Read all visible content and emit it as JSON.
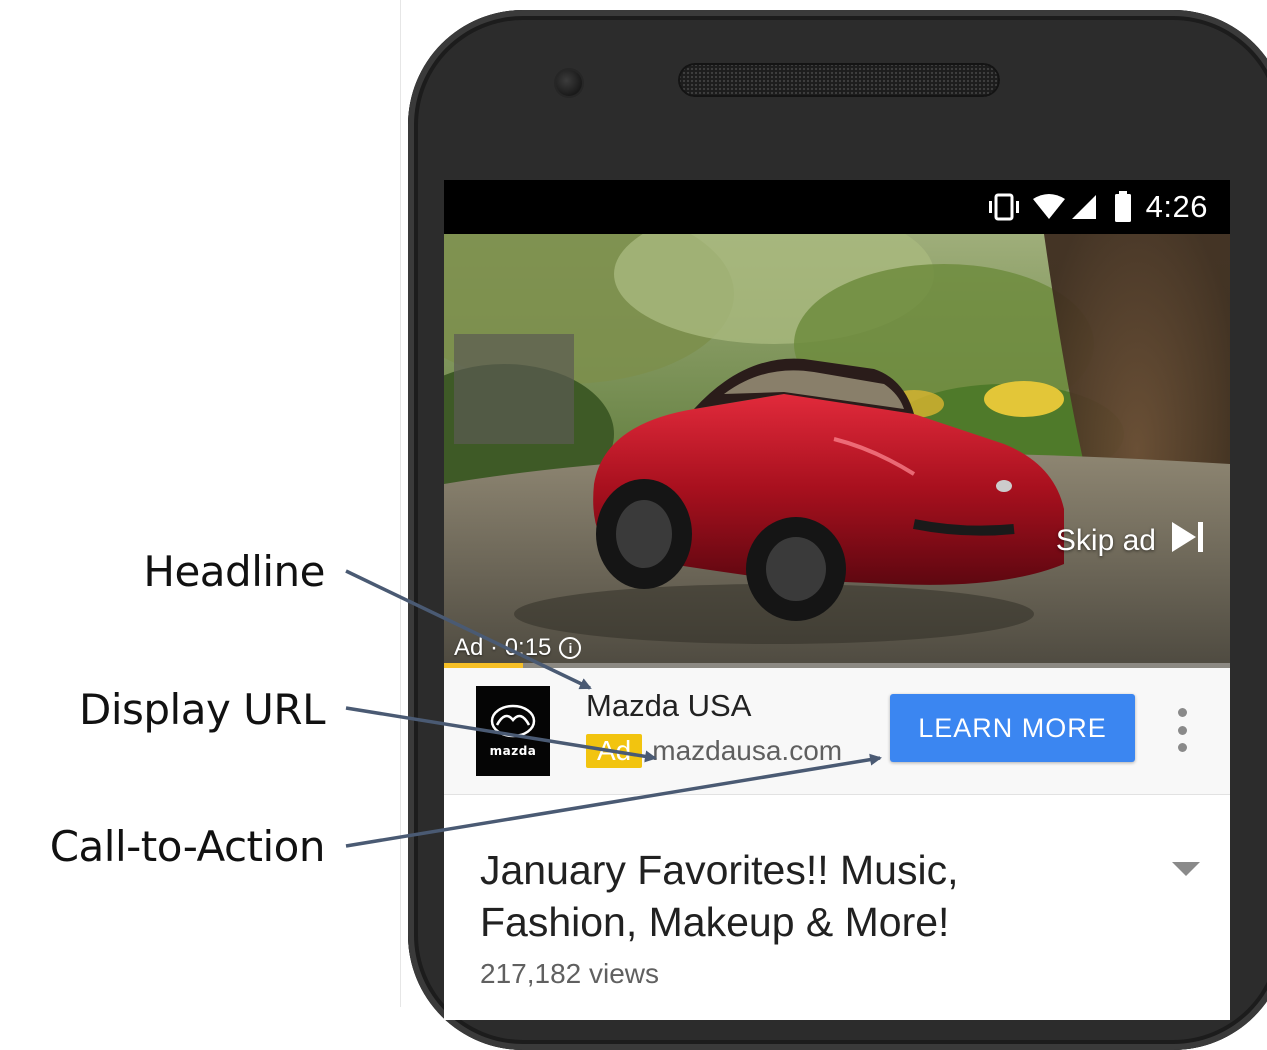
{
  "annotations": {
    "headline": "Headline",
    "display_url": "Display URL",
    "call_to_action": "Call-to-Action"
  },
  "status_bar": {
    "time": "4:26",
    "icons": [
      "vibrate-icon",
      "wifi-icon",
      "signal-icon",
      "battery-icon"
    ]
  },
  "video": {
    "skip_label": "Skip ad",
    "ad_timer": "Ad · 0:15",
    "progress": 0.1
  },
  "ad": {
    "headline": "Mazda USA",
    "badge": "Ad",
    "display_url": "mazdausa.com",
    "cta_label": "LEARN MORE",
    "logo_wordmark": "mazda"
  },
  "video_info": {
    "title": "January Favorites!! Music, Fashion, Makeup & More!",
    "views": "217,182 views"
  },
  "colors": {
    "cta_blue": "#3b86f1",
    "ad_badge_yellow": "#f2c40f",
    "progress_yellow": "#f6bf26",
    "arrow_color": "#4a5a73"
  }
}
